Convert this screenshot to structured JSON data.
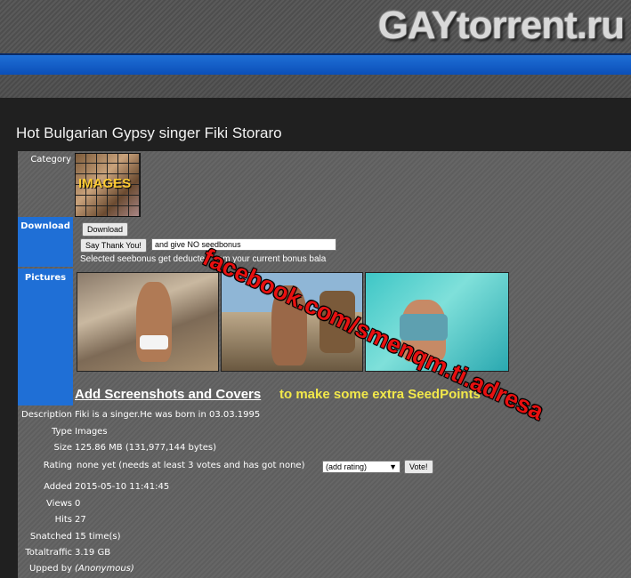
{
  "site": {
    "logo_text": "GAYtorrent.ru"
  },
  "torrent": {
    "title": "Hot Bulgarian Gypsy singer Fiki Storaro",
    "labels": {
      "category": "Category",
      "download": "Download",
      "pictures": "Pictures",
      "description": "Description",
      "type": "Type",
      "size": "Size",
      "rating": "Rating",
      "added": "Added",
      "views": "Views",
      "hits": "Hits",
      "snatched": "Snatched",
      "totaltraffic": "Totaltraffic",
      "upped_by": "Upped by"
    },
    "category_image_text": "IMAGES",
    "download_button": "Download",
    "say_thanks_button": "Say Thank You!",
    "seedbonus_option": "and give NO seedbonus",
    "seedbonus_note": "Selected seebonus get deducted from your current bonus bala",
    "add_screenshots_link": "Add Screenshots and Covers",
    "add_screenshots_rest": "to make some extra SeedPoints",
    "description": "Fiki is a singer.He was born in 03.03.1995",
    "type": "Images",
    "size": "125.86 MB (131,977,144 bytes)",
    "rating": "none yet (needs at least 3 votes and has got none)",
    "rating_select": "(add rating)",
    "vote_button": "Vote!",
    "added": "2015-05-10 11:41:45",
    "views": "0",
    "hits": "27",
    "snatched": "15 time(s)",
    "totaltraffic": "3.19 GB",
    "upped_by": "(Anonymous)"
  },
  "watermark": "facebook.com/smenqm.ti.adresa",
  "colors": {
    "accent_blue": "#1f6fd6",
    "highlight_yellow": "#f2e84a",
    "watermark_red": "#e81010"
  }
}
